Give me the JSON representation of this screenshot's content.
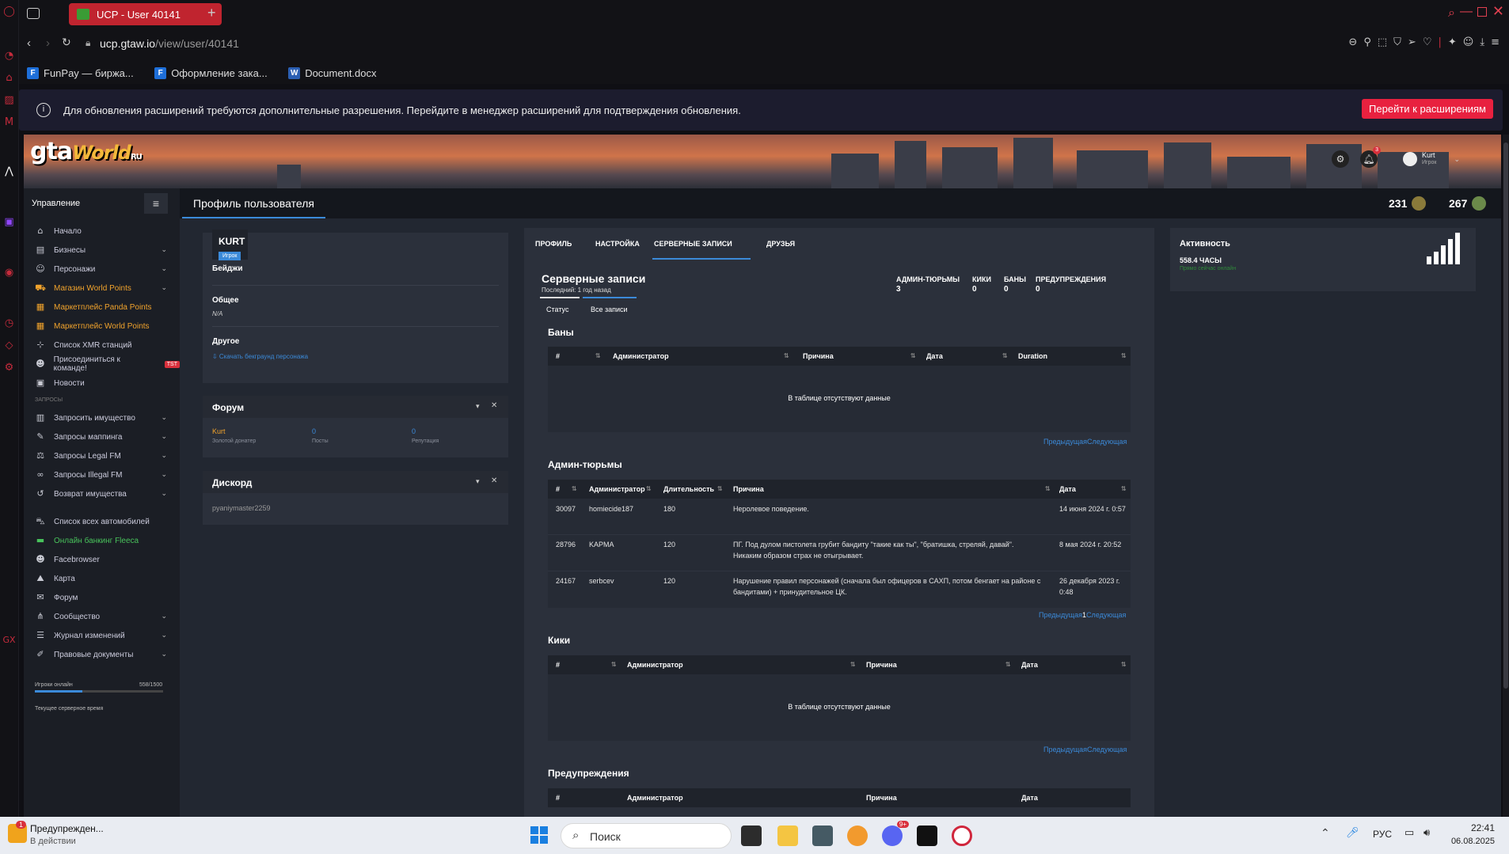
{
  "browser": {
    "tab_title": "UCP - User 40141",
    "url_host": "ucp.gtaw.io",
    "url_path": "/view/user/40141",
    "bookmarks": [
      "FunPay — биржа...",
      "Оформление зака...",
      "Document.docx"
    ],
    "info_text": "Для обновления расширений требуются дополнительные разрешения. Перейдите в менеджер расширений для подтверждения обновления.",
    "info_button": "Перейти к расширениям"
  },
  "header": {
    "logo_main": "gta",
    "logo_sub": "World",
    "logo_ru": "RU",
    "user_name": "Kurt",
    "user_role": "Игрок",
    "notif_count": "3",
    "points_a": "231",
    "points_b": "267"
  },
  "subheader": {
    "sidebar_title": "Управление",
    "page_title": "Профиль пользователя"
  },
  "sidebar": {
    "items": [
      "Начало",
      "Бизнесы",
      "Персонажи",
      "Магазин World Points",
      "Маркетплейс Panda Points",
      "Маркетплейс World Points",
      "Список XMR станций",
      "Присоединиться к команде!",
      "Новости"
    ],
    "team_tag": "TST",
    "section_requests": "ЗАПРОСЫ",
    "req_items": [
      "Запросить имущество",
      "Запросы маппинга",
      "Запросы Legal FM",
      "Запросы Illegal FM",
      "Возврат имущества"
    ],
    "other_items": [
      "Список всех автомобилей",
      "Онлайн банкинг Fleeca",
      "Facebrowser",
      "Карта",
      "Форум",
      "Сообщество",
      "Журнал изменений",
      "Правовые документы"
    ],
    "players_label": "Игроки онлайн",
    "players_value": "558/1500",
    "players_fraction": 0.372,
    "server_time_label": "Текущее серверное время"
  },
  "profile": {
    "name": "KURT",
    "role_badge": "Игрок",
    "badges_label": "Бейджи",
    "general_label": "Общее",
    "general_value": "N/A",
    "other_label": "Другое",
    "download_link": "⇩ Скачать бекграунд персонажа"
  },
  "forum": {
    "title": "Форум",
    "user": "Kurt",
    "user_sub": "Золотой донатер",
    "posts_value": "0",
    "posts_label": "Посты",
    "rep_value": "0",
    "rep_label": "Репутация"
  },
  "discord": {
    "title": "Дискорд",
    "username": "pyaniymaster2259"
  },
  "tabs": [
    "ПРОФИЛЬ",
    "НАСТРОЙКА",
    "СЕРВЕРНЫЕ ЗАПИСИ",
    "ДРУЗЬЯ"
  ],
  "records": {
    "title": "Серверные записи",
    "last": "Последний: 1 год назад",
    "stats": [
      {
        "label": "АДМИН-ТЮРЬМЫ",
        "value": "3"
      },
      {
        "label": "КИКИ",
        "value": "0"
      },
      {
        "label": "БАНЫ",
        "value": "0"
      },
      {
        "label": "ПРЕДУПРЕЖДЕНИЯ",
        "value": "0"
      }
    ],
    "subtabs": [
      "Статус",
      "Все записи"
    ],
    "empty_text": "В таблице отсутствуют данные",
    "pager_prev": "Предыдущая",
    "pager_next": "Следующая",
    "pager_page": "1",
    "bans": {
      "title": "Баны",
      "headers": [
        "#",
        "Администратор",
        "Причина",
        "Дата",
        "Duration"
      ]
    },
    "jails": {
      "title": "Админ-тюрьмы",
      "headers": [
        "#",
        "Администратор",
        "Длительность",
        "Причина",
        "Дата"
      ],
      "rows": [
        {
          "id": "30097",
          "admin": "homiecide187",
          "dur": "180",
          "reason": "Неролевое поведение.",
          "date": "14 июня 2024 г. 0:57"
        },
        {
          "id": "28796",
          "admin": "KAPMA",
          "dur": "120",
          "reason": "ПГ. Под дулом пистолета грубит бандиту \"такие как ты\", \"братишка, стреляй, давай\". Никаким образом страх не отыгрывает.",
          "date": "8 мая 2024 г. 20:52"
        },
        {
          "id": "24167",
          "admin": "serbcev",
          "dur": "120",
          "reason": "Нарушение правил персонажей (сначала был офицеров в САХП, потом бенгает на районе с бандитами) + принудительное ЦК.",
          "date": "26 декабря 2023 г. 0:48"
        }
      ]
    },
    "kicks": {
      "title": "Кики",
      "headers": [
        "#",
        "Администратор",
        "Причина",
        "Дата"
      ]
    },
    "warns": {
      "title": "Предупреждения",
      "headers": [
        "#",
        "Администратор",
        "Причина",
        "Дата"
      ]
    }
  },
  "activity": {
    "title": "Активность",
    "hours": "558.4 ЧАСЫ",
    "status": "Прямо сейчас онлайн"
  },
  "taskbar": {
    "notif_count": "1",
    "notif_title": "Предупрежден...",
    "notif_sub": "В действии",
    "search": "Поиск",
    "lang": "РУС",
    "time": "22:41",
    "date": "06.08.2025",
    "discord_badge": "9+"
  },
  "colors": {
    "accent": "#3b8ad9",
    "brand": "#c0242f",
    "orange": "#f1a32c",
    "green": "#48c25b"
  }
}
